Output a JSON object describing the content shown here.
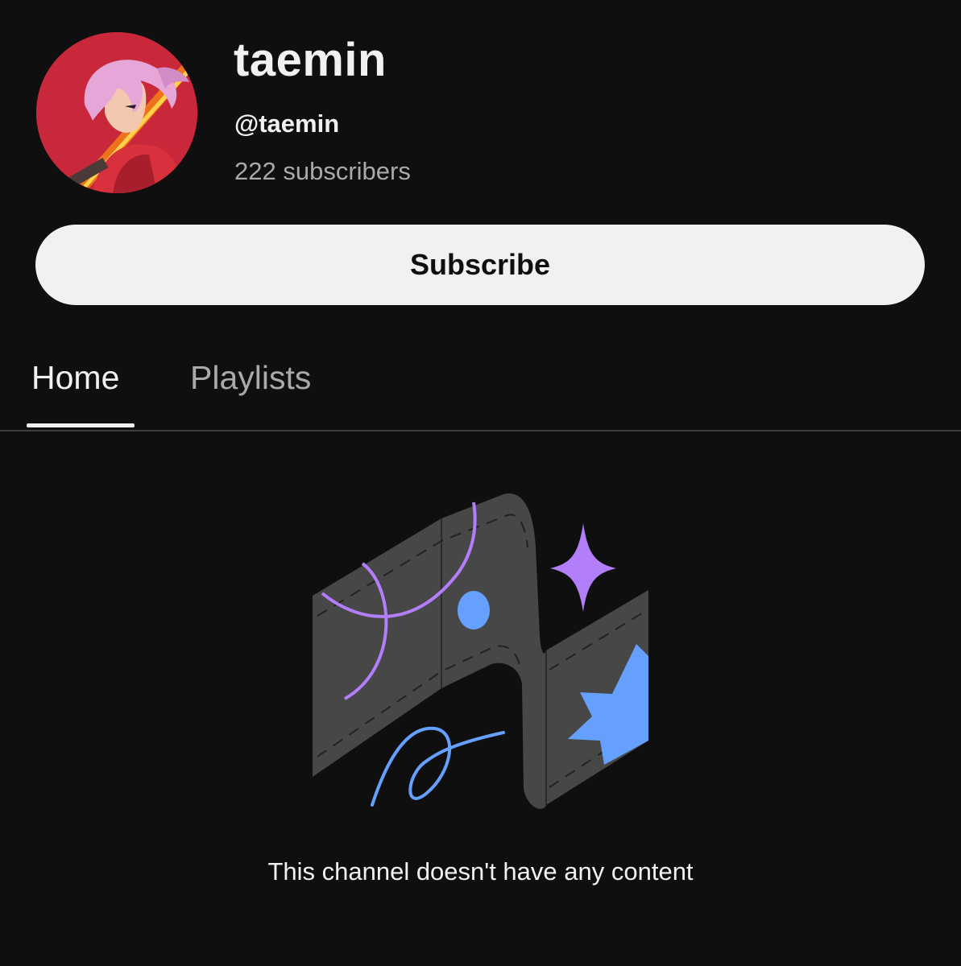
{
  "channel": {
    "name": "taemin",
    "handle": "@taemin",
    "subscribers": "222 subscribers",
    "avatar_icon": "anime-avatar-icon"
  },
  "actions": {
    "subscribe_label": "Subscribe"
  },
  "tabs": [
    {
      "label": "Home",
      "selected": true
    },
    {
      "label": "Playlists",
      "selected": false
    }
  ],
  "empty_state": {
    "illustration_icon": "empty-channel-illustration",
    "message": "This channel doesn't have any content"
  },
  "colors": {
    "background": "#0f0f0f",
    "button_bg": "#f1f1f1",
    "accent_purple": "#b37ef9",
    "accent_blue": "#65a0ff",
    "avatar_red": "#c8283a"
  }
}
